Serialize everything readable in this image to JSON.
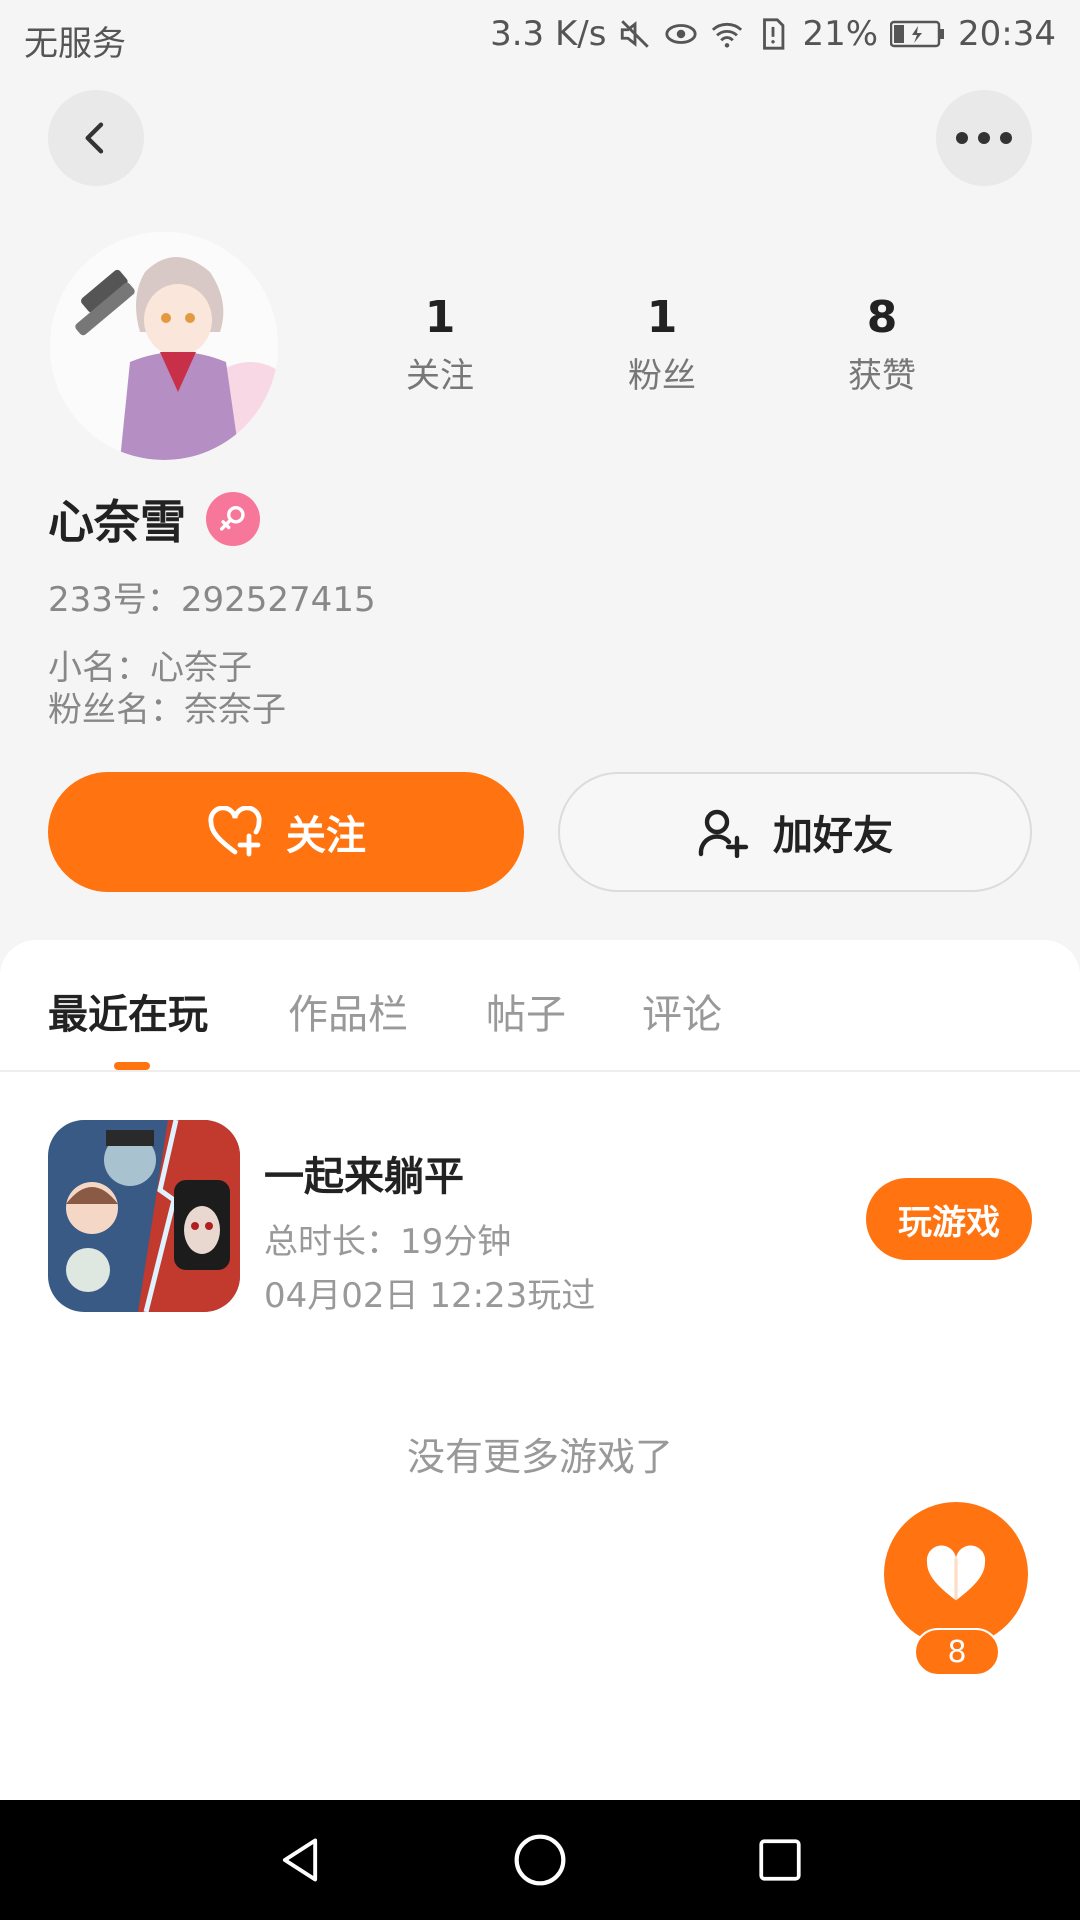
{
  "status_bar": {
    "carrier": "无服务",
    "speed": "3.3 K/s",
    "battery": "21%",
    "time": "20:34",
    "icons": [
      "mute-icon",
      "eye-icon",
      "wifi-icon",
      "sim-alert-icon",
      "battery-icon"
    ]
  },
  "profile": {
    "username": "心奈雪",
    "gender": "female",
    "id_line": "233号：292527415",
    "nickname_line": "小名：心奈子",
    "fan_name_line": "粉丝名：奈奈子",
    "stats": [
      {
        "value": "1",
        "label": "关注"
      },
      {
        "value": "1",
        "label": "粉丝"
      },
      {
        "value": "8",
        "label": "获赞"
      }
    ]
  },
  "actions": {
    "follow_label": "关注",
    "add_friend_label": "加好友"
  },
  "tabs": [
    {
      "label": "最近在玩",
      "active": true
    },
    {
      "label": "作品栏",
      "active": false
    },
    {
      "label": "帖子",
      "active": false
    },
    {
      "label": "评论",
      "active": false
    }
  ],
  "games": [
    {
      "title": "一起来躺平",
      "duration": "总时长：19分钟",
      "last_played": "04月02日 12:23玩过",
      "play_label": "玩游戏"
    }
  ],
  "no_more_text": "没有更多游戏了",
  "like_fab": {
    "count": "8"
  },
  "colors": {
    "accent": "#ff7310",
    "female_badge": "#f7779a",
    "background": "#f5f5f5"
  }
}
